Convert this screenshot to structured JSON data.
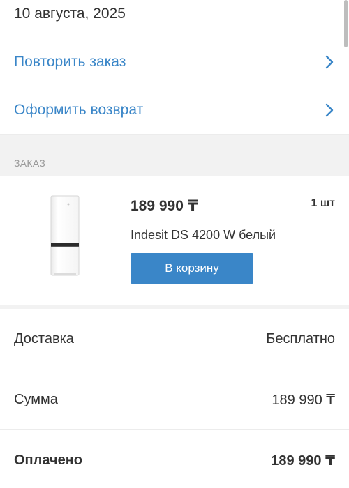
{
  "order_date": "10 августа, 2025",
  "actions": {
    "repeat_label": "Повторить заказ",
    "return_label": "Оформить возврат"
  },
  "section": {
    "order_header": "ЗАКАЗ"
  },
  "item": {
    "price": "189 990 ₸",
    "quantity": "1 шт",
    "name": "Indesit DS 4200 W белый",
    "cart_button": "В корзину"
  },
  "summary": {
    "delivery_label": "Доставка",
    "delivery_value": "Бесплатно",
    "sum_label": "Сумма",
    "sum_value": "189 990 ₸",
    "paid_label": "Оплачено",
    "paid_value": "189 990 ₸"
  },
  "colors": {
    "accent": "#3a86c8",
    "section_bg": "#f2f2f2",
    "text": "#333333"
  },
  "icons": [
    "chevron-right-icon",
    "fridge-image"
  ]
}
